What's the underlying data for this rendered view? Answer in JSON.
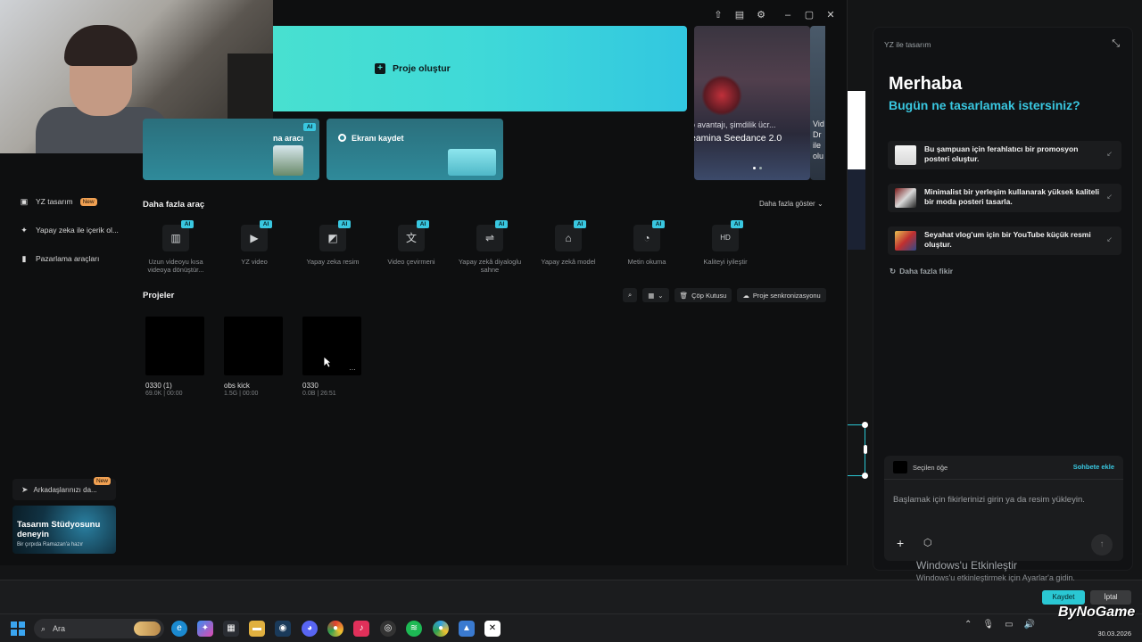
{
  "sidebar": {
    "items": [
      {
        "label": "YZ tasarım",
        "badge": "New",
        "icon": "ai-design-icon"
      },
      {
        "label": "Yapay zeka ile içerik ol...",
        "icon": "sparkle-icon"
      },
      {
        "label": "Pazarlama araçları",
        "icon": "marketing-icon"
      }
    ],
    "invite": {
      "label": "Arkadaşlarınızı da...",
      "badge": "New"
    },
    "promo": {
      "title": "Tasarım Stüdyosunu deneyin",
      "subtitle": "Bir çırpıda Ramazan'a hazır"
    }
  },
  "hero": {
    "create_label": "Proje oluştur"
  },
  "cards": [
    {
      "label": "na aracı",
      "tag": "AI"
    },
    {
      "label": "Ekranı kaydet"
    }
  ],
  "banner": {
    "small": "o avantajı, şimdilik ücr...",
    "big": "eamina Seedance 2.0"
  },
  "banner2": {
    "line1": "Vid",
    "line2": "Dr",
    "line3": "ile",
    "line4": "olu"
  },
  "tools_section": {
    "title": "Daha fazla araç",
    "more_label": "Daha fazla göster",
    "items": [
      {
        "label": "Uzun videoyu kısa videoya dönüştür...",
        "tag": "AI",
        "icon": "film-icon"
      },
      {
        "label": "YZ video",
        "tag": "AI",
        "icon": "video-plus-icon"
      },
      {
        "label": "Yapay zeka resim",
        "tag": "AI",
        "icon": "image-plus-icon"
      },
      {
        "label": "Video çevirmeni",
        "tag": "AI",
        "icon": "translate-icon"
      },
      {
        "label": "Yapay zekâ diyaloglu sahne",
        "tag": "AI",
        "icon": "dialog-icon"
      },
      {
        "label": "Yapay zekâ model",
        "tag": "AI",
        "icon": "shirt-icon"
      },
      {
        "label": "Metin okuma",
        "tag": "AI",
        "icon": "voice-icon"
      },
      {
        "label": "Kaliteyi iyileştir",
        "tag": "AI",
        "icon": "hd-icon"
      }
    ]
  },
  "projects": {
    "title": "Projeler",
    "trash_label": "Çöp Kutusu",
    "sync_label": "Proje senkronizasyonu",
    "items": [
      {
        "name": "0330 (1)",
        "meta": "69.0K | 00:00"
      },
      {
        "name": "obs kick",
        "meta": "1.5G | 00:00"
      },
      {
        "name": "0330",
        "meta": "0.0B | 26:51"
      }
    ]
  },
  "ai_panel": {
    "title": "YZ ile tasarım",
    "greeting": "Merhaba",
    "question": "Bugün ne tasarlamak istersiniz?",
    "suggestions": [
      {
        "text": "Bu şampuan için ferahlatıcı bir promosyon posteri oluştur."
      },
      {
        "text": "Minimalist bir yerleşim kullanarak yüksek kaliteli bir moda posteri tasarla."
      },
      {
        "text": "Seyahat vlog'um için bir YouTube küçük resmi oluştur."
      }
    ],
    "more_ideas": "Daha fazla fikir",
    "selected_label": "Seçilen öğe",
    "add_to_chat": "Sohbete ekle",
    "placeholder": "Başlamak için fikirlerinizi girin ya da resim yükleyin."
  },
  "bottom": {
    "save": "Kaydet",
    "cancel": "İptal"
  },
  "activation": {
    "title": "Windows'u Etkinleştir",
    "subtitle": "Windows'u etkinleştirmek için Ayarlar'a gidin."
  },
  "taskbar": {
    "search_label": "Ara",
    "time": "30.03.2026"
  },
  "watermark": "ByNoGame",
  "colors": {
    "accent": "#39c7e0",
    "hero": "#48e0d0",
    "new_badge": "#f0a052"
  }
}
